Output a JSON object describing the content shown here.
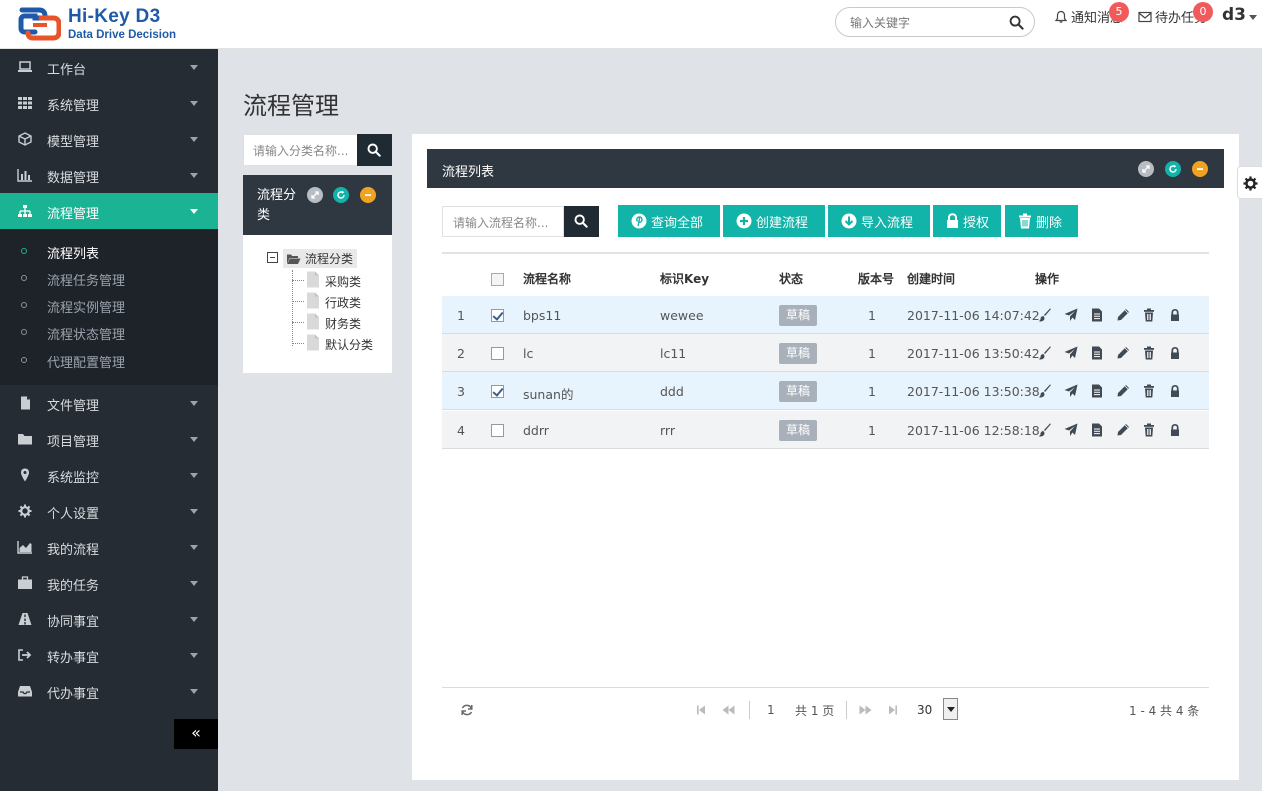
{
  "brand": {
    "name": "Hi-Key D3",
    "tagline": "Data Drive Decision"
  },
  "topbar": {
    "search_placeholder": "输入关键字",
    "notifications": {
      "label": "通知消息",
      "count": "5"
    },
    "todo": {
      "label": "待办任务",
      "count": "0"
    },
    "user": "d3"
  },
  "sidebar": {
    "items": [
      {
        "label": "工作台",
        "icon": "laptop-icon"
      },
      {
        "label": "系统管理",
        "icon": "grid-icon"
      },
      {
        "label": "模型管理",
        "icon": "cube-icon"
      },
      {
        "label": "数据管理",
        "icon": "bar-chart-icon"
      },
      {
        "label": "流程管理",
        "icon": "sitemap-icon"
      },
      {
        "label": "文件管理",
        "icon": "file-icon"
      },
      {
        "label": "项目管理",
        "icon": "folder-icon"
      },
      {
        "label": "系统监控",
        "icon": "map-marker-icon"
      },
      {
        "label": "个人设置",
        "icon": "gear-icon"
      },
      {
        "label": "我的流程",
        "icon": "area-chart-icon"
      },
      {
        "label": "我的任务",
        "icon": "briefcase-icon"
      },
      {
        "label": "协同事宜",
        "icon": "road-icon"
      },
      {
        "label": "转办事宜",
        "icon": "sign-out-icon"
      },
      {
        "label": "代办事宜",
        "icon": "inbox-icon"
      }
    ],
    "submenu": [
      {
        "label": "流程列表"
      },
      {
        "label": "流程任务管理"
      },
      {
        "label": "流程实例管理"
      },
      {
        "label": "流程状态管理"
      },
      {
        "label": "代理配置管理"
      }
    ],
    "collapse_label": "«"
  },
  "page": {
    "title": "流程管理"
  },
  "category": {
    "search_placeholder": "请输入分类名称...",
    "panel_title": "流程分类",
    "tree_root": "流程分类",
    "tree_items": [
      "采购类",
      "行政类",
      "财务类",
      "默认分类"
    ]
  },
  "list": {
    "panel_title": "流程列表",
    "search_placeholder": "请输入流程名称...",
    "buttons": {
      "query_all": "查询全部",
      "create": "创建流程",
      "import": "导入流程",
      "authorize": "授权",
      "delete": "删除"
    },
    "columns": {
      "name": "流程名称",
      "key": "标识Key",
      "status": "状态",
      "version": "版本号",
      "created": "创建时间",
      "actions": "操作"
    },
    "rows": [
      {
        "index": "1",
        "checked": true,
        "name": "bps11",
        "key": "wewee",
        "status": "草稿",
        "version": "1",
        "created": "2017-11-06 14:07:42"
      },
      {
        "index": "2",
        "checked": false,
        "name": "lc",
        "key": "lc11",
        "status": "草稿",
        "version": "1",
        "created": "2017-11-06 13:50:42"
      },
      {
        "index": "3",
        "checked": true,
        "name": "sunan的",
        "key": "ddd",
        "status": "草稿",
        "version": "1",
        "created": "2017-11-06 13:50:38"
      },
      {
        "index": "4",
        "checked": false,
        "name": "ddrr",
        "key": "rrr",
        "status": "草稿",
        "version": "1",
        "created": "2017-11-06 12:58:18"
      }
    ],
    "pagination": {
      "current_page": "1",
      "total_pages": "共 1 页",
      "page_size": "30",
      "summary": "1 - 4 共 4 条"
    }
  },
  "colors": {
    "accent": "#1ab394",
    "button": "#12b3a8",
    "sidebar_bg": "#262c33",
    "panel_header": "#2f3740",
    "badge": "#f15a5a",
    "status": "#a8b1b9"
  }
}
